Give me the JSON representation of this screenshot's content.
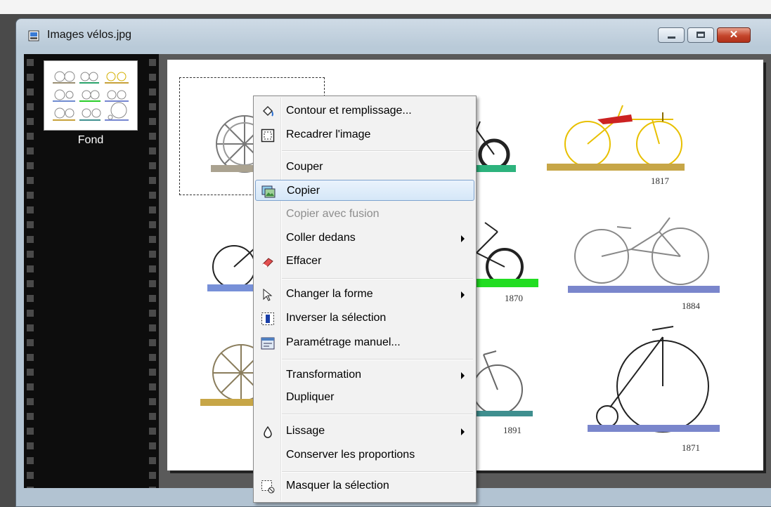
{
  "window": {
    "title": "Images vélos.jpg",
    "close_glyph": "✕"
  },
  "filmstrip": {
    "layer_label": "Fond"
  },
  "image": {
    "years": [
      "1817",
      "1870",
      "1884",
      "1891",
      "1871"
    ]
  },
  "context_menu": {
    "items": [
      {
        "label": "Contour et remplissage...",
        "icon": "paint-bucket-icon"
      },
      {
        "label": "Recadrer l'image",
        "icon": "crop-icon"
      },
      {
        "label": "Couper"
      },
      {
        "label": "Copier",
        "icon": "copy-image-icon",
        "state": "highlighted"
      },
      {
        "label": "Copier avec fusion",
        "state": "disabled"
      },
      {
        "label": "Coller dedans",
        "submenu": true
      },
      {
        "label": "Effacer",
        "icon": "eraser-icon"
      },
      {
        "label": "Changer la forme",
        "icon": "pointer-arrow-icon",
        "submenu": true
      },
      {
        "label": "Inverser la sélection",
        "icon": "invert-selection-icon"
      },
      {
        "label": "Paramétrage manuel...",
        "icon": "manual-settings-icon"
      },
      {
        "label": "Transformation",
        "submenu": true
      },
      {
        "label": "Dupliquer"
      },
      {
        "label": "Lissage",
        "icon": "drop-icon",
        "submenu": true
      },
      {
        "label": "Conserver les proportions"
      },
      {
        "label": "Masquer la sélection",
        "icon": "hide-selection-icon"
      }
    ]
  }
}
